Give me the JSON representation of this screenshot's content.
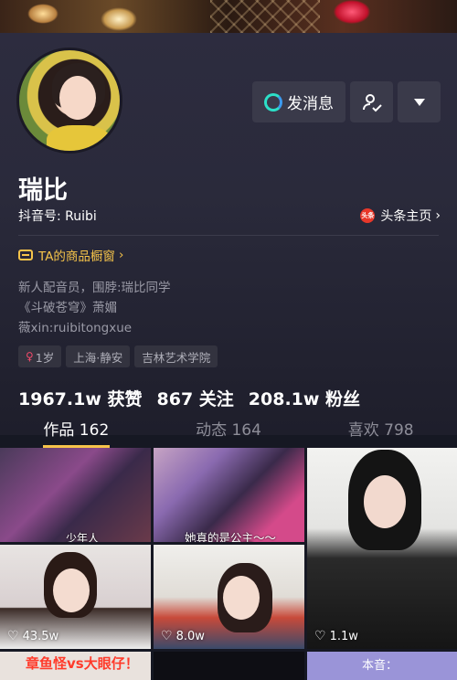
{
  "profile": {
    "name": "瑞比",
    "douyin_id": "抖音号: Ruibi",
    "toutiao_link": "头条主页",
    "toutiao_logo": "头条",
    "shop_label": "TA的商品橱窗",
    "bio": [
      "新人配音员，围脖:瑞比同学",
      "《斗破苍穹》萧媚",
      "薇xin:ruibitongxue"
    ],
    "tags": [
      "1岁",
      "上海·静安",
      "吉林艺术学院"
    ],
    "stats": [
      "1967.1w 获赞",
      "867 关注",
      "208.1w 粉丝"
    ]
  },
  "actions": {
    "message_label": "发消息"
  },
  "tabs": [
    "作品 162",
    "动态 164",
    "喜欢 798"
  ],
  "videos": {
    "captions": [
      "少年人",
      "她真的是公主～～"
    ],
    "likes": [
      "43.5w",
      "8.0w",
      "1.1w"
    ],
    "bottom_texts": [
      "章鱼怪vs大眼仔！",
      "本音："
    ]
  },
  "colors": {
    "accent": "#f6c44a",
    "background": "#161823",
    "button": "#3a3a4a"
  }
}
